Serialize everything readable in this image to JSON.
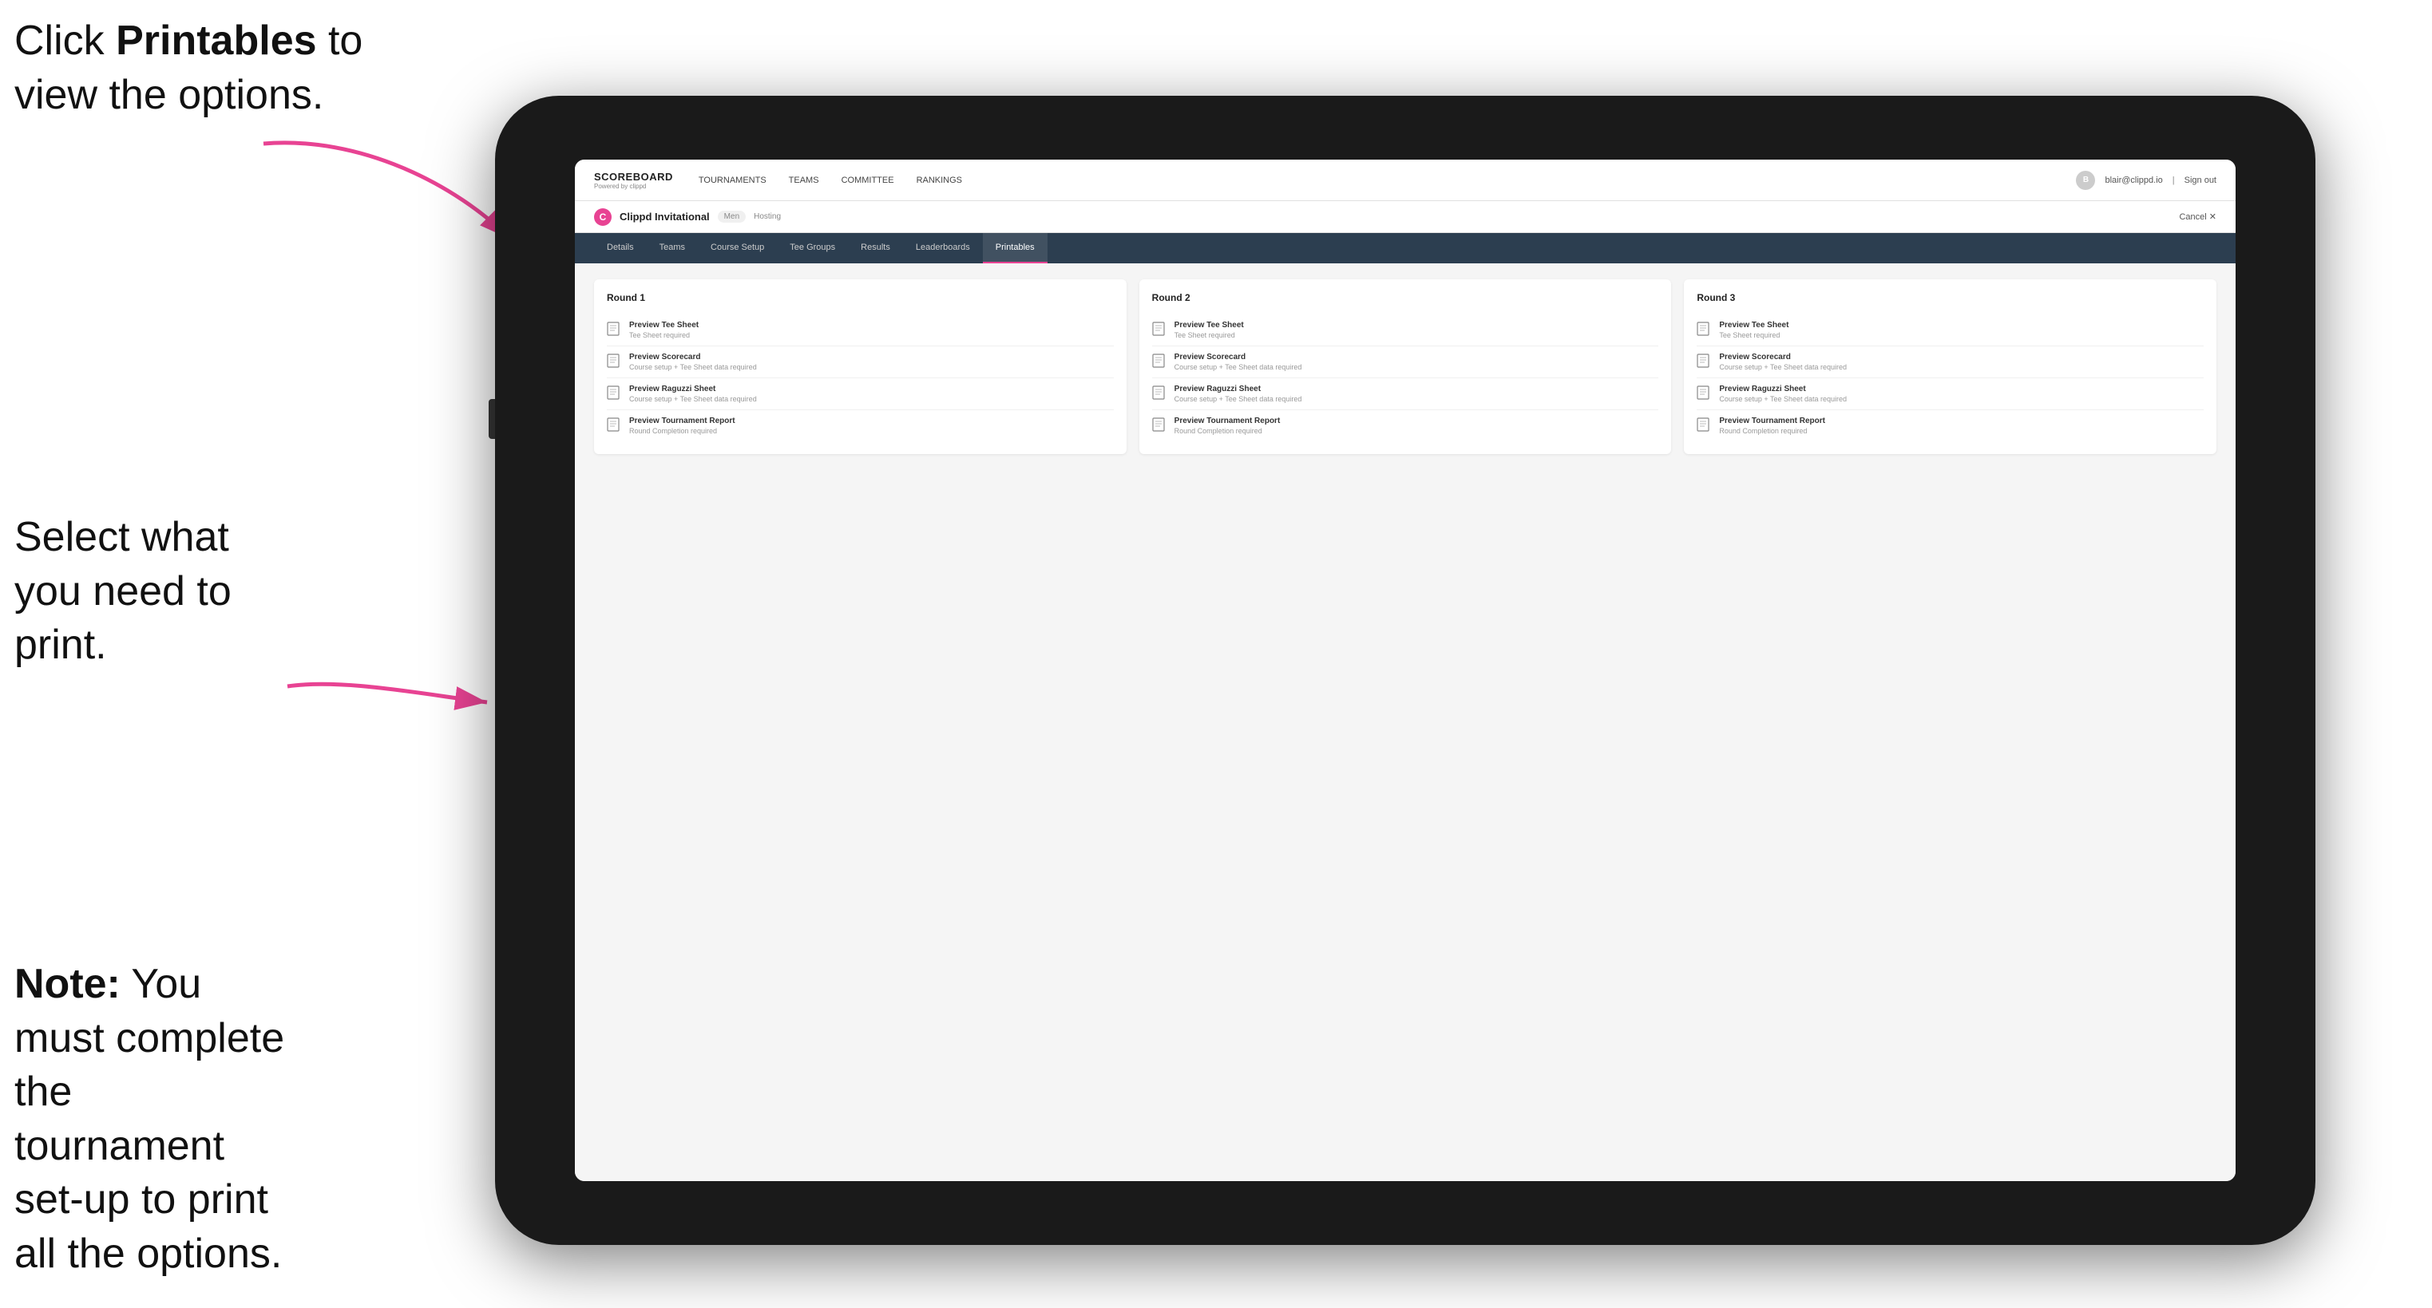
{
  "annotations": {
    "top": {
      "line1": "Click ",
      "bold": "Printables",
      "line2": " to",
      "line3": "view the options."
    },
    "middle": {
      "text": "Select what you need to print."
    },
    "bottom": {
      "bold": "Note:",
      "text": " You must complete the tournament set-up to print all the options."
    }
  },
  "nav": {
    "brand_title": "SCOREBOARD",
    "brand_sub": "Powered by clippd",
    "links": [
      {
        "label": "TOURNAMENTS",
        "active": false
      },
      {
        "label": "TEAMS",
        "active": false
      },
      {
        "label": "COMMITTEE",
        "active": false
      },
      {
        "label": "RANKINGS",
        "active": false
      }
    ],
    "user_email": "blair@clippd.io",
    "sign_out": "Sign out"
  },
  "tournament": {
    "logo_letter": "C",
    "name": "Clippd Invitational",
    "gender": "Men",
    "status": "Hosting",
    "cancel": "Cancel"
  },
  "tabs": [
    {
      "label": "Details",
      "active": false
    },
    {
      "label": "Teams",
      "active": false
    },
    {
      "label": "Course Setup",
      "active": false
    },
    {
      "label": "Tee Groups",
      "active": false
    },
    {
      "label": "Results",
      "active": false
    },
    {
      "label": "Leaderboards",
      "active": false
    },
    {
      "label": "Printables",
      "active": true
    }
  ],
  "rounds": [
    {
      "title": "Round 1",
      "items": [
        {
          "title": "Preview Tee Sheet",
          "subtitle": "Tee Sheet required"
        },
        {
          "title": "Preview Scorecard",
          "subtitle": "Course setup + Tee Sheet data required"
        },
        {
          "title": "Preview Raguzzi Sheet",
          "subtitle": "Course setup + Tee Sheet data required"
        },
        {
          "title": "Preview Tournament Report",
          "subtitle": "Round Completion required"
        }
      ]
    },
    {
      "title": "Round 2",
      "items": [
        {
          "title": "Preview Tee Sheet",
          "subtitle": "Tee Sheet required"
        },
        {
          "title": "Preview Scorecard",
          "subtitle": "Course setup + Tee Sheet data required"
        },
        {
          "title": "Preview Raguzzi Sheet",
          "subtitle": "Course setup + Tee Sheet data required"
        },
        {
          "title": "Preview Tournament Report",
          "subtitle": "Round Completion required"
        }
      ]
    },
    {
      "title": "Round 3",
      "items": [
        {
          "title": "Preview Tee Sheet",
          "subtitle": "Tee Sheet required"
        },
        {
          "title": "Preview Scorecard",
          "subtitle": "Course setup + Tee Sheet data required"
        },
        {
          "title": "Preview Raguzzi Sheet",
          "subtitle": "Course setup + Tee Sheet data required"
        },
        {
          "title": "Preview Tournament Report",
          "subtitle": "Round Completion required"
        }
      ]
    }
  ]
}
